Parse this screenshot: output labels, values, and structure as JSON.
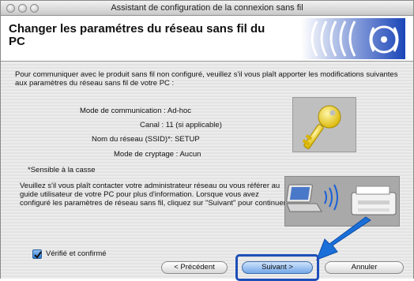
{
  "window": {
    "title": "Assistant de configuration de la connexion sans fil"
  },
  "header": {
    "title": "Changer les paramétres du réseau sans fil du PC"
  },
  "intro": "Pour communiquer avec le produit sans fil non configuré, veuillez s'il vous plaît apporter les modifications suivantes aux paramètres du réseau sans fil de votre PC :",
  "settings": [
    {
      "label": "Mode de communication :",
      "value": "Ad-hoc"
    },
    {
      "label": "Canal :",
      "value": "11  (si applicable)"
    },
    {
      "label": "Nom du réseau (SSID)*:",
      "value": "SETUP"
    },
    {
      "label": "Mode de cryptage :",
      "value": "Aucun"
    }
  ],
  "note": "*Sensible à la casse",
  "paragraph": "Veuillez s'il vous plaît contacter votre administrateur réseau ou vous référer au guide utilisateur de votre PC pour plus d'information. Lorsque vous avez configuré les paramètres de réseau sans fil, cliquez sur \"Suivant\" pour continuer.",
  "checkbox": {
    "label": "Vérifié et confirmé",
    "checked": true
  },
  "buttons": {
    "previous": "< Précédent",
    "next": "Suivant >",
    "cancel": "Annuler"
  },
  "icons": {
    "logo": "wireless-signal-icon",
    "key": "key-icon",
    "network": "laptop-printer-icon",
    "arrow": "pointer-arrow-icon"
  },
  "colors": {
    "accent": "#1d4fb8",
    "arrow": "#1a6fd8"
  }
}
